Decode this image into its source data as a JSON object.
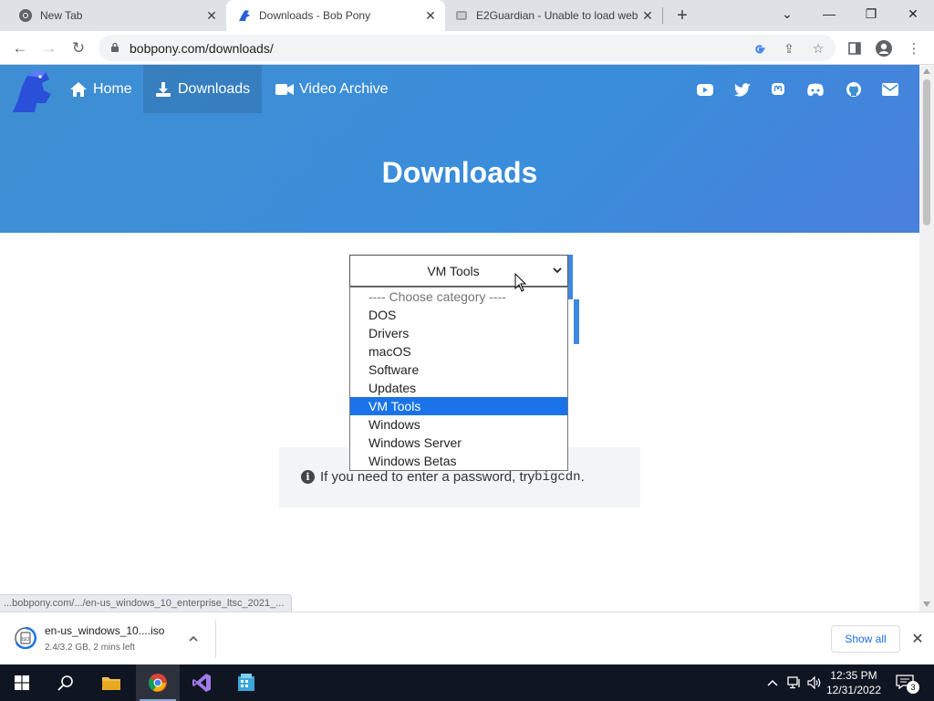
{
  "browser": {
    "tabs": [
      {
        "title": "New Tab",
        "icon": "chrome-icon",
        "active": false
      },
      {
        "title": "Downloads - Bob Pony",
        "icon": "bobpony-favicon",
        "active": true
      },
      {
        "title": "E2Guardian - Unable to load web",
        "icon": "e2guardian-favicon",
        "active": false
      }
    ],
    "new_tab_label": "+",
    "url": "bobpony.com/downloads/",
    "accent_color": "#1a73e8"
  },
  "site": {
    "nav": [
      {
        "label": "Home",
        "icon": "home-icon"
      },
      {
        "label": "Downloads",
        "icon": "download-icon"
      },
      {
        "label": "Video Archive",
        "icon": "video-camera-icon"
      }
    ],
    "social_icons": [
      "youtube-icon",
      "twitter-icon",
      "mastodon-icon",
      "discord-icon",
      "github-icon",
      "email-icon"
    ],
    "hero_title": "Downloads",
    "hero_color": "#3f8ed3",
    "select": {
      "value": "VM Tools",
      "options": [
        "---- Choose category ----",
        "DOS",
        "Drivers",
        "macOS",
        "Software",
        "Updates",
        "VM Tools",
        "Windows",
        "Windows Server",
        "Windows Betas"
      ],
      "selected_index": 6
    },
    "info": {
      "prefix": "If you need to enter a password, try ",
      "code": "bigcdn",
      "suffix": "."
    }
  },
  "status_bar_url": "...bobpony.com/.../en-us_windows_10_enterprise_ltsc_2021_...",
  "download_shelf": {
    "file_name": "en-us_windows_10....iso",
    "status": "2.4/3.2 GB, 2 mins left",
    "show_all_label": "Show all"
  },
  "taskbar": {
    "apps": [
      "windows-start-icon",
      "search-icon",
      "file-explorer-icon",
      "chrome-icon",
      "visual-studio-icon",
      "app-icon"
    ],
    "time": "12:35 PM",
    "date": "12/31/2022",
    "notification_count": "3"
  }
}
